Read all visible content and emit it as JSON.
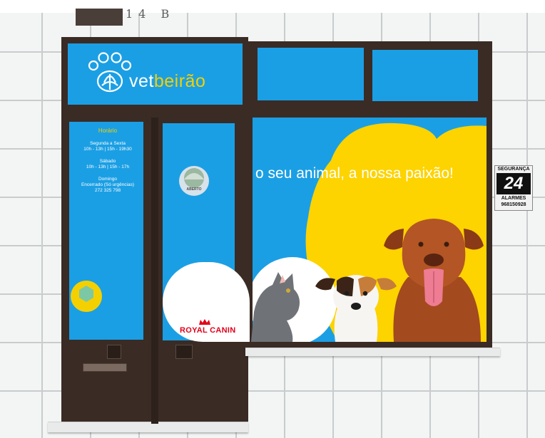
{
  "storefront": {
    "house_number": "14 B",
    "brand": {
      "name_part1": "vet",
      "name_part2": "beirão"
    },
    "hours": {
      "title": "Horário",
      "weekdays_label": "Segunda a Sexta",
      "weekdays_time": "10h - 13h | 15h - 19h30",
      "saturday_label": "Sábado",
      "saturday_time": "10h - 13h | 15h - 17h",
      "sunday_label": "Domingo",
      "sunday_note": "Encerrado (Só urgências)",
      "phone": "272 325 798"
    },
    "slogan": "o seu animal, a nossa paixão!",
    "sponsor": "ROYAL CANIN",
    "sticker_label": "ABERTO",
    "security_sign": {
      "top": "SEGURANÇA",
      "number": "24",
      "label": "ALARMES",
      "phone": "968150928"
    },
    "colors": {
      "brand_blue": "#1b9fe4",
      "accent_yellow": "#f4d000",
      "frame_brown": "#3a2b25"
    }
  }
}
